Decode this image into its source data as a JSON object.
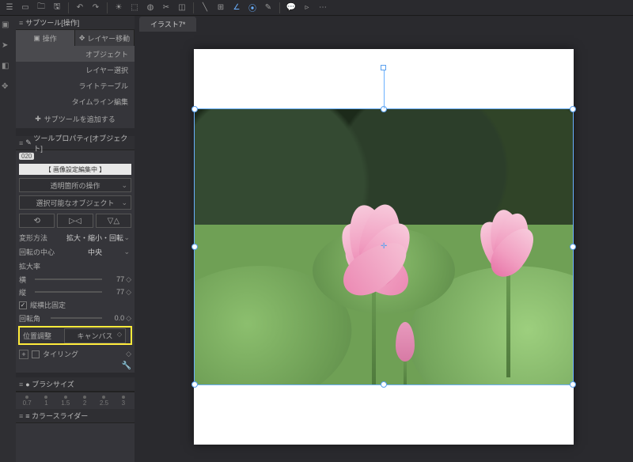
{
  "topbar": {
    "title": ""
  },
  "doc": {
    "tab": "イラスト7*"
  },
  "subtool": {
    "header": "サブツール[操作]",
    "tabs": [
      {
        "label": "操作",
        "active": true
      },
      {
        "label": "レイヤー移動",
        "active": false
      }
    ],
    "items": [
      {
        "label": "オブジェクト",
        "active": true
      },
      {
        "label": "レイヤー選択",
        "active": false
      },
      {
        "label": "ライトテーブル",
        "active": false
      },
      {
        "label": "タイムライン編集",
        "active": false
      }
    ],
    "add": "サブツールを追加する"
  },
  "toolprop": {
    "header": "ツールプロパティ[オブジェクト]",
    "badge": "020",
    "editing": "【 画像設定編集中 】",
    "transparent_op": "透明箇所の操作",
    "selectable": "選択可能なオブジェクト",
    "transform_method_lbl": "変形方法",
    "transform_method_val": "拡大・縮小・回転",
    "rotation_center_lbl": "回転の中心",
    "rotation_center_val": "中央",
    "scale_lbl": "拡大率",
    "width_lbl": "横",
    "width_val": "77",
    "height_lbl": "縦",
    "height_val": "77",
    "lock_aspect": "縦横比固定",
    "angle_lbl": "回転角",
    "angle_val": "0.0",
    "position_lbl": "位置調整",
    "position_val": "キャンバス",
    "tiling": "タイリング"
  },
  "brush": {
    "header": "ブラシサイズ",
    "sizes": [
      "0.7",
      "1",
      "1.5",
      "2",
      "2.5",
      "3"
    ]
  },
  "colorslider": {
    "header": "カラースライダー"
  }
}
